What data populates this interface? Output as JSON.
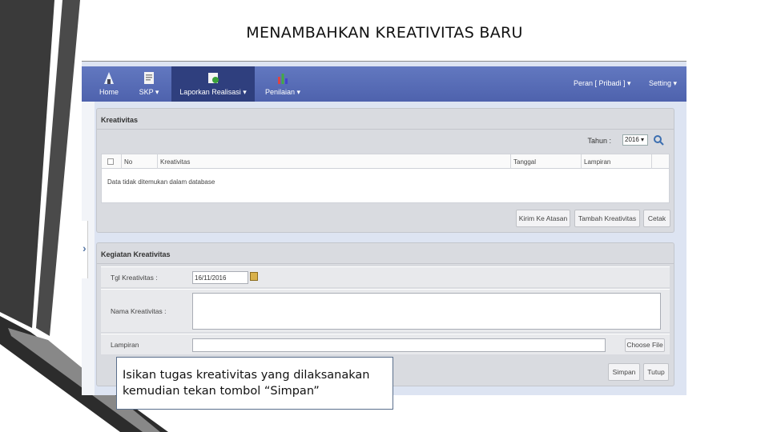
{
  "slide": {
    "title": "MENAMBAHKAN KREATIVITAS BARU",
    "callout_text": "Isikan tugas kreativitas  yang dilaksanakan kemudian tekan tombol “Simpan”"
  },
  "navbar": {
    "items": [
      {
        "label": "Home",
        "icon": "home-icon"
      },
      {
        "label": "SKP ▾",
        "icon": "document-icon"
      },
      {
        "label": "Laporkan Realisasi ▾",
        "icon": "report-icon"
      },
      {
        "label": "Penilaian ▾",
        "icon": "chart-icon"
      }
    ],
    "right_items": [
      "Peran [ Pribadi ] ▾",
      "Setting ▾"
    ]
  },
  "kreativitas_panel": {
    "title": "Kreativitas",
    "tahun_label": "Tahun  :",
    "tahun_value": "2016 ▾",
    "columns": [
      "No",
      "Kreativitas",
      "Tanggal",
      "Lampiran"
    ],
    "empty_message": "Data tidak ditemukan dalam database",
    "buttons": {
      "kirim": "Kirim Ke Atasan",
      "tambah": "Tambah Kreativitas",
      "cetak": "Cetak"
    }
  },
  "kegiatan_panel": {
    "title": "Kegiatan Kreativitas",
    "tgl_label": "Tgl Kreativitas :",
    "tgl_value": "16/11/2016",
    "nama_label": "Nama Kreativitas :",
    "nama_value": "",
    "lampiran_label": "Lampiran",
    "choose_file": "Choose File",
    "buttons": {
      "simpan": "Simpan",
      "tutup": "Tutup"
    }
  },
  "colors": {
    "navbar": "#5669b5",
    "navbar_active": "#2f3f7e",
    "app_background": "#dde4f2",
    "panel": "#d9dbe0"
  }
}
